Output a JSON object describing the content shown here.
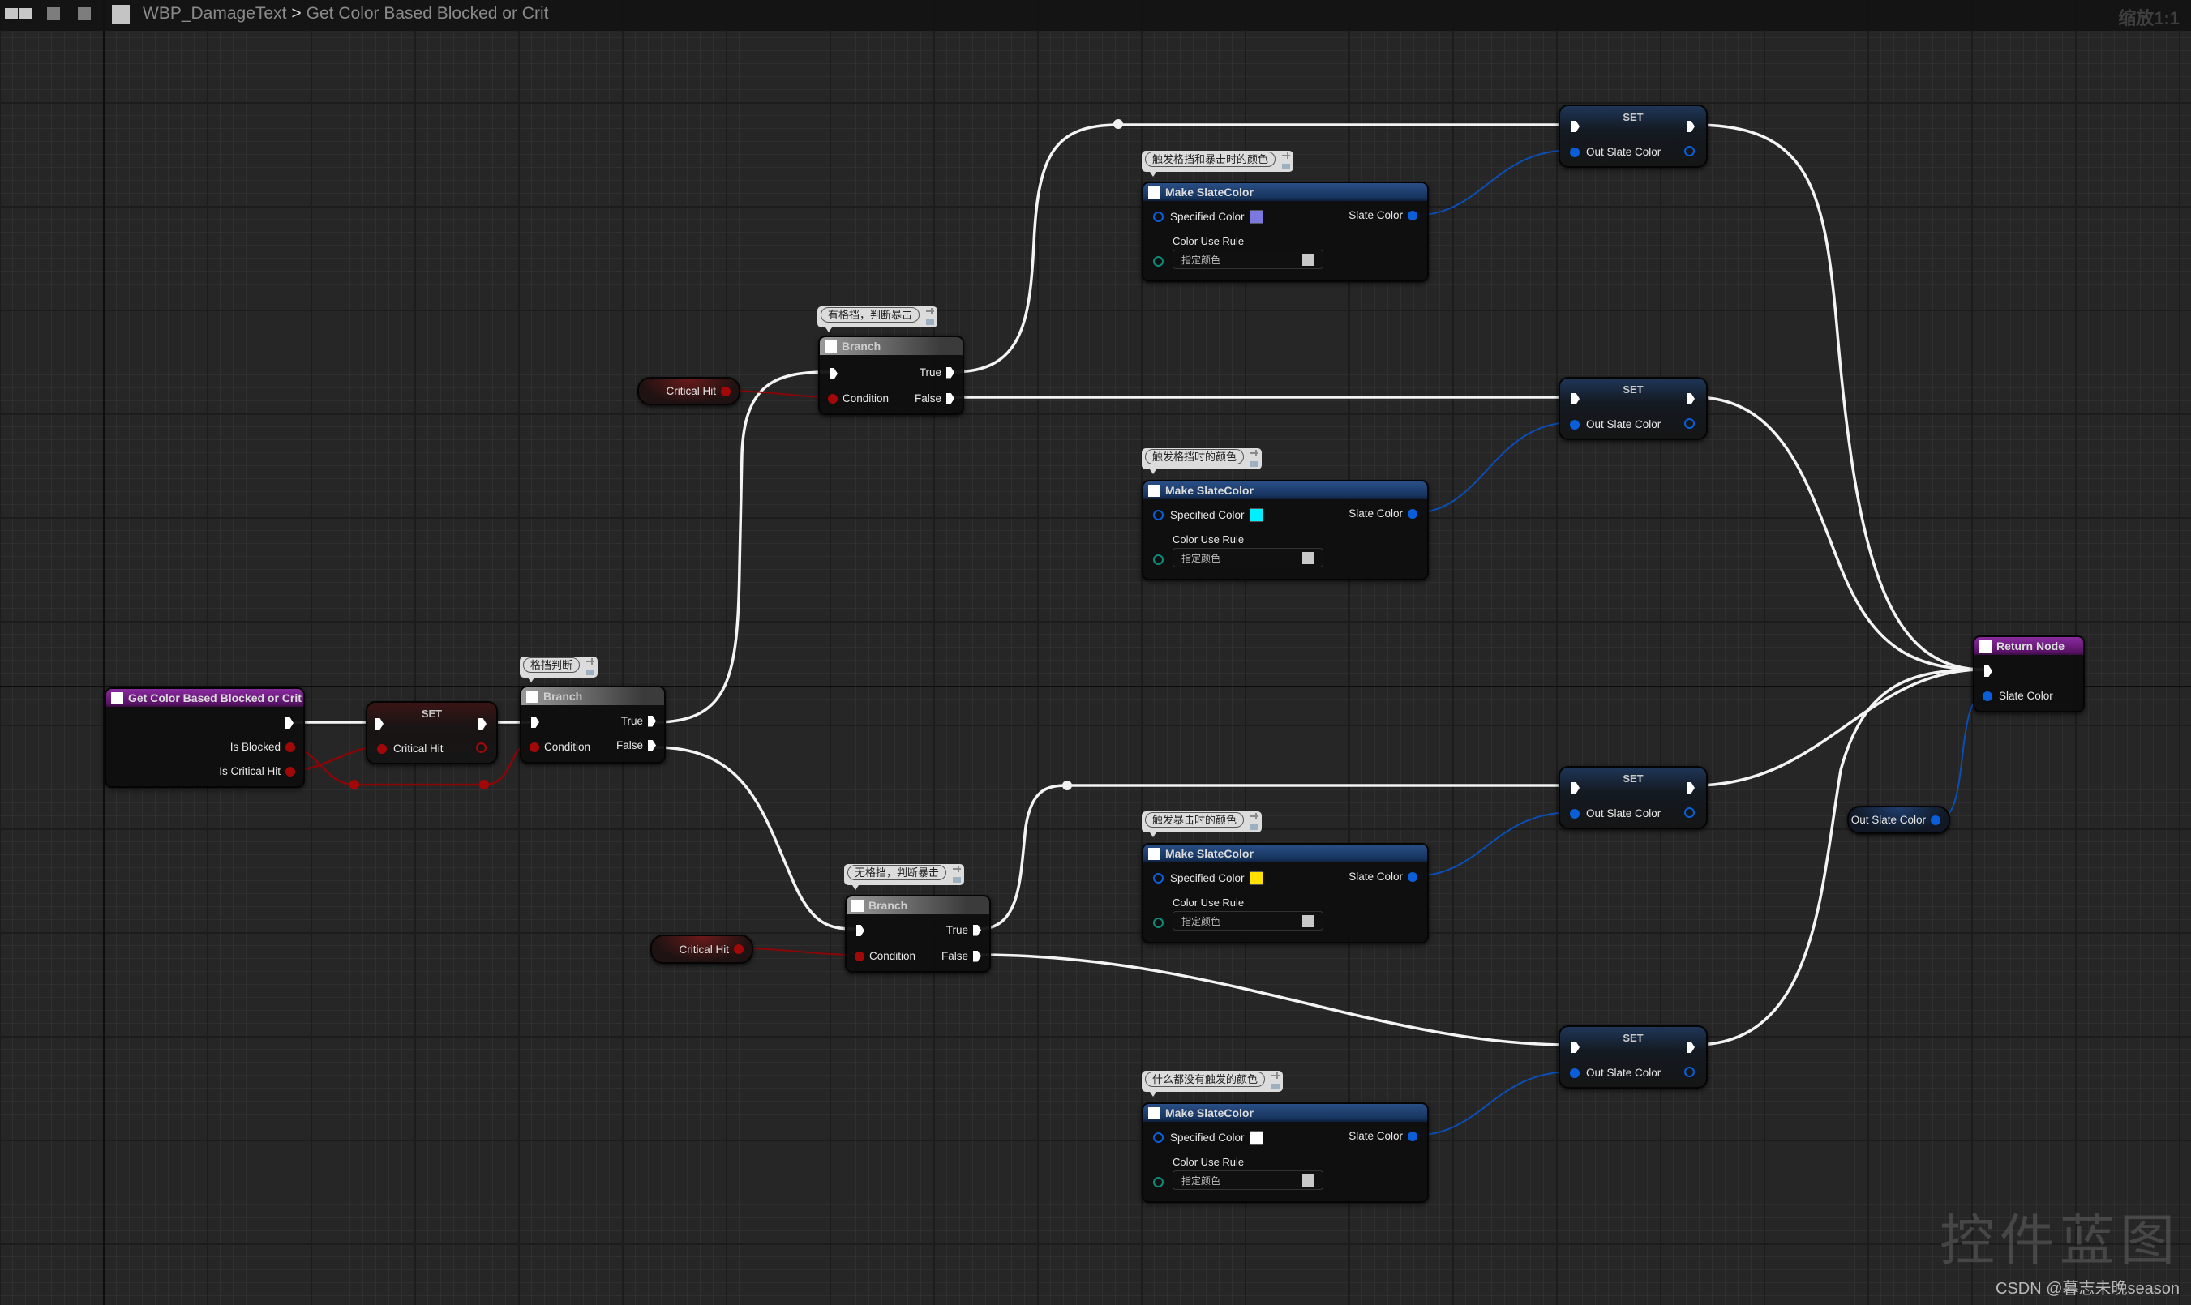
{
  "window": {
    "breadcrumb": [
      "WBP_DamageText",
      "Get Color Based Blocked or Crit"
    ],
    "breadcrumb_separator": ">",
    "zoom_label": "缩放1:1"
  },
  "nodes": {
    "entry": {
      "title": "Get Color Based Blocked or Crit",
      "pins": [
        "Is Blocked",
        "Is Critical Hit"
      ]
    },
    "set_critical": {
      "title": "SET",
      "pin": "Critical Hit"
    },
    "branch_blocked": {
      "comment": "格挡判断",
      "title": "Branch",
      "condition": "Condition",
      "true_label": "True",
      "false_label": "False"
    },
    "get_critical_top": {
      "label": "Critical Hit"
    },
    "branch_blocked_crit": {
      "comment": "有格挡，判断暴击",
      "title": "Branch",
      "condition": "Condition",
      "true_label": "True",
      "false_label": "False"
    },
    "branch_noblock_crit": {
      "comment": "无格挡，判断暴击",
      "title": "Branch",
      "condition": "Condition",
      "true_label": "True",
      "false_label": "False"
    },
    "get_critical_bottom": {
      "label": "Critical Hit"
    },
    "make_colors": [
      {
        "comment": "触发格挡和暴击时的颜色",
        "title": "Make SlateColor",
        "specified_label": "Specified Color",
        "color": "#7b78e0",
        "output": "Slate Color",
        "rule_label": "Color Use Rule",
        "rule_value": "指定颜色"
      },
      {
        "comment": "触发格挡时的颜色",
        "title": "Make SlateColor",
        "specified_label": "Specified Color",
        "color": "#00f0ff",
        "output": "Slate Color",
        "rule_label": "Color Use Rule",
        "rule_value": "指定颜色"
      },
      {
        "comment": "触发暴击时的颜色",
        "title": "Make SlateColor",
        "specified_label": "Specified Color",
        "color": "#ffe000",
        "output": "Slate Color",
        "rule_label": "Color Use Rule",
        "rule_value": "指定颜色"
      },
      {
        "comment": "什么都没有触发的颜色",
        "title": "Make SlateColor",
        "specified_label": "Specified Color",
        "color": "#ffffff",
        "output": "Slate Color",
        "rule_label": "Color Use Rule",
        "rule_value": "指定颜色"
      }
    ],
    "set_out": [
      {
        "title": "SET",
        "pin": "Out Slate Color"
      },
      {
        "title": "SET",
        "pin": "Out Slate Color"
      },
      {
        "title": "SET",
        "pin": "Out Slate Color"
      },
      {
        "title": "SET",
        "pin": "Out Slate Color"
      }
    ],
    "get_out_color": {
      "label": "Out Slate Color"
    },
    "return": {
      "title": "Return Node",
      "pin": "Slate Color"
    }
  },
  "colors": {
    "function_header": "#7a1f8f",
    "pure_header": "#1f4272",
    "bool_pin": "#a30808",
    "struct_pin": "#0a5fd8",
    "exec_wire": "#ffffff"
  },
  "watermark": {
    "title": "控件蓝图",
    "credit": "CSDN @暮志未晚season"
  }
}
